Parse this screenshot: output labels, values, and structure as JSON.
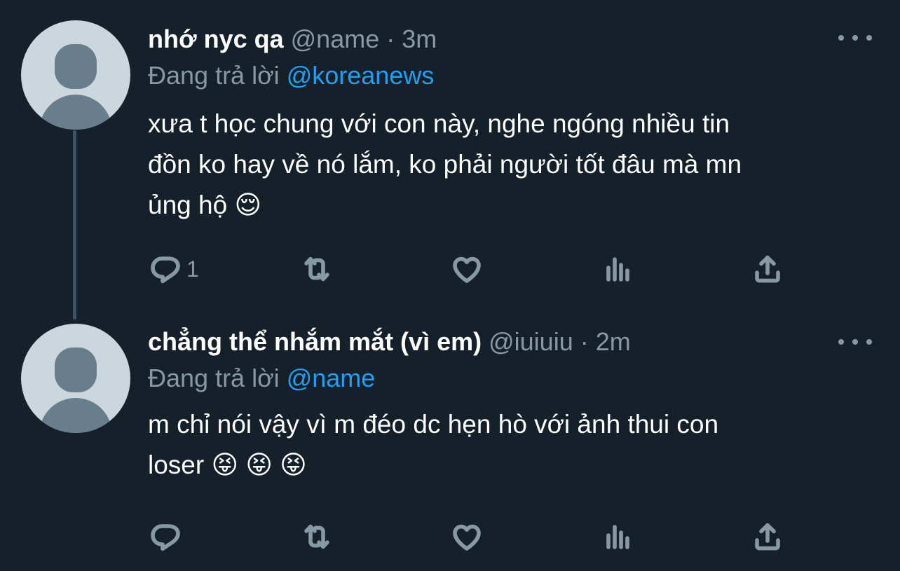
{
  "tweets": [
    {
      "display_name": "nhớ nyc qa",
      "handle": "@name",
      "separator": "·",
      "time": "3m",
      "reply_prefix": "Đang trả lời",
      "reply_to": "@koreanews",
      "text": "xưa t học chung với con này, nghe ngóng nhiều tin\nđồn ko hay về nó lắm, ko phải người tốt đâu mà mn\nủng hộ 😌",
      "reply_count": "1",
      "icons": [
        "reply-icon",
        "retweet-icon",
        "like-icon",
        "analytics-icon",
        "share-icon",
        "more-icon"
      ]
    },
    {
      "display_name": "chẳng thể nhắm mắt (vì em)",
      "handle": "@iuiuiu",
      "separator": "·",
      "time": "2m",
      "reply_prefix": "Đang trả lời",
      "reply_to": "@name",
      "text": "m chỉ nói vậy vì m đéo dc hẹn hò với ảnh thui con\nloser 😝 😝 😝",
      "reply_count": "",
      "icons": [
        "reply-icon",
        "retweet-icon",
        "like-icon",
        "analytics-icon",
        "share-icon",
        "more-icon"
      ]
    }
  ],
  "colors": {
    "background": "#15202b",
    "primary_text": "#ffffff",
    "secondary_text": "#8899a6",
    "link": "#1da1f2",
    "avatar_bg": "#ccd6dd",
    "avatar_fg": "#687e8c",
    "thread_line": "#3d5466"
  }
}
